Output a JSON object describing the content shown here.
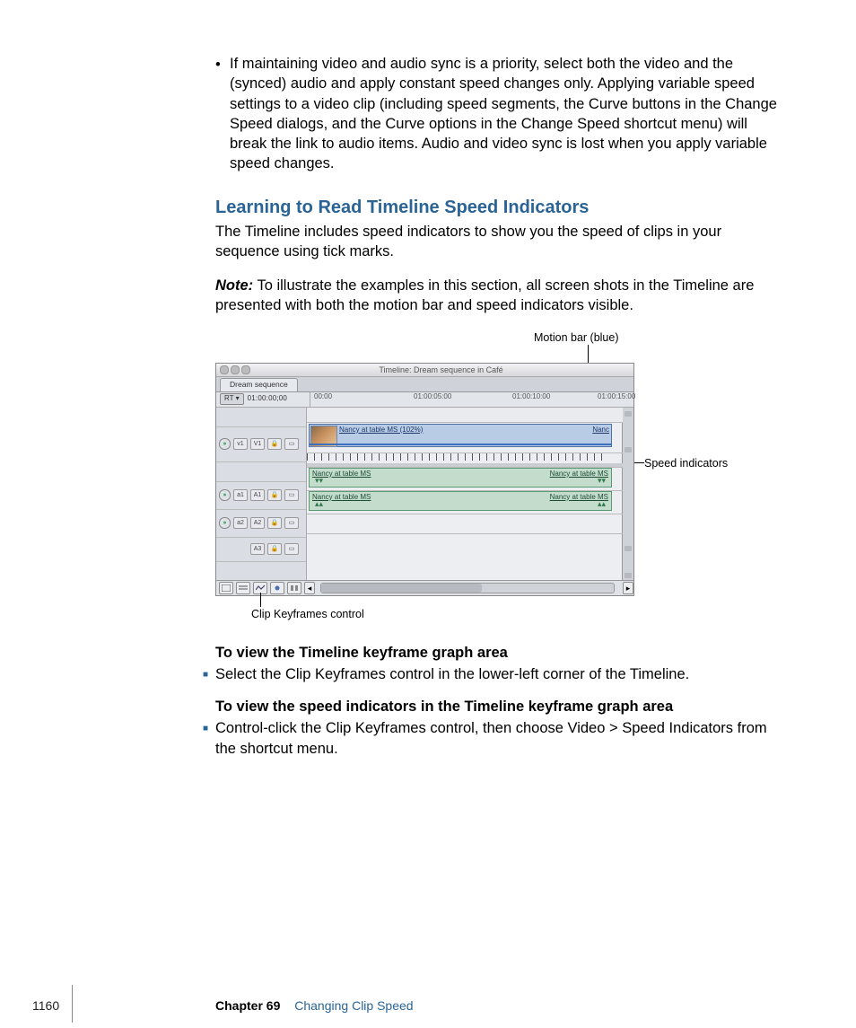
{
  "bullet_intro": "If maintaining video and audio sync is a priority, select both the video and the (synced) audio and apply constant speed changes only. Applying variable speed settings to a video clip (including speed segments, the Curve buttons in the Change Speed dialogs, and the Curve options in the Change Speed shortcut menu) will break the link to audio items. Audio and video sync is lost when you apply variable speed changes.",
  "section_heading": "Learning to Read Timeline Speed Indicators",
  "section_para": "The Timeline includes speed indicators to show you the speed of clips in your sequence using tick marks.",
  "note_label": "Note:",
  "note_text": "  To illustrate the examples in this section, all screen shots in the Timeline are presented with both the motion bar and speed indicators visible.",
  "callout_motion": "Motion bar (blue)",
  "callout_speed": "Speed indicators",
  "callout_ckf": "Clip Keyframes control",
  "timeline": {
    "title": "Timeline: Dream sequence in Café",
    "tab": "Dream sequence",
    "rt_label": "RT ▾",
    "timecode": "01:00:00;00",
    "ruler": [
      "00:00",
      "01:00:05:00",
      "01:00:10:00",
      "01:00:15:00"
    ],
    "tracks": {
      "v1": {
        "src": "v1",
        "dst": "V1"
      },
      "a1": {
        "src": "a1",
        "dst": "A1"
      },
      "a2": {
        "src": "a2",
        "dst": "A2"
      },
      "a3": {
        "dst": "A3"
      }
    },
    "video_clip": {
      "name": "Nancy at table MS (102%)",
      "right": "Nanc"
    },
    "audio_clip": {
      "left": "Nancy at table MS",
      "right": "Nancy at table MS"
    }
  },
  "step1_head": "To view the Timeline keyframe graph area",
  "step1_item": "Select the Clip Keyframes control in the lower-left corner of the Timeline.",
  "step2_head": "To view the speed indicators in the Timeline keyframe graph area",
  "step2_item": "Control-click the Clip Keyframes control, then choose Video > Speed Indicators from the shortcut menu.",
  "footer": {
    "page": "1160",
    "chapter": "Chapter 69",
    "title": "Changing Clip Speed"
  }
}
